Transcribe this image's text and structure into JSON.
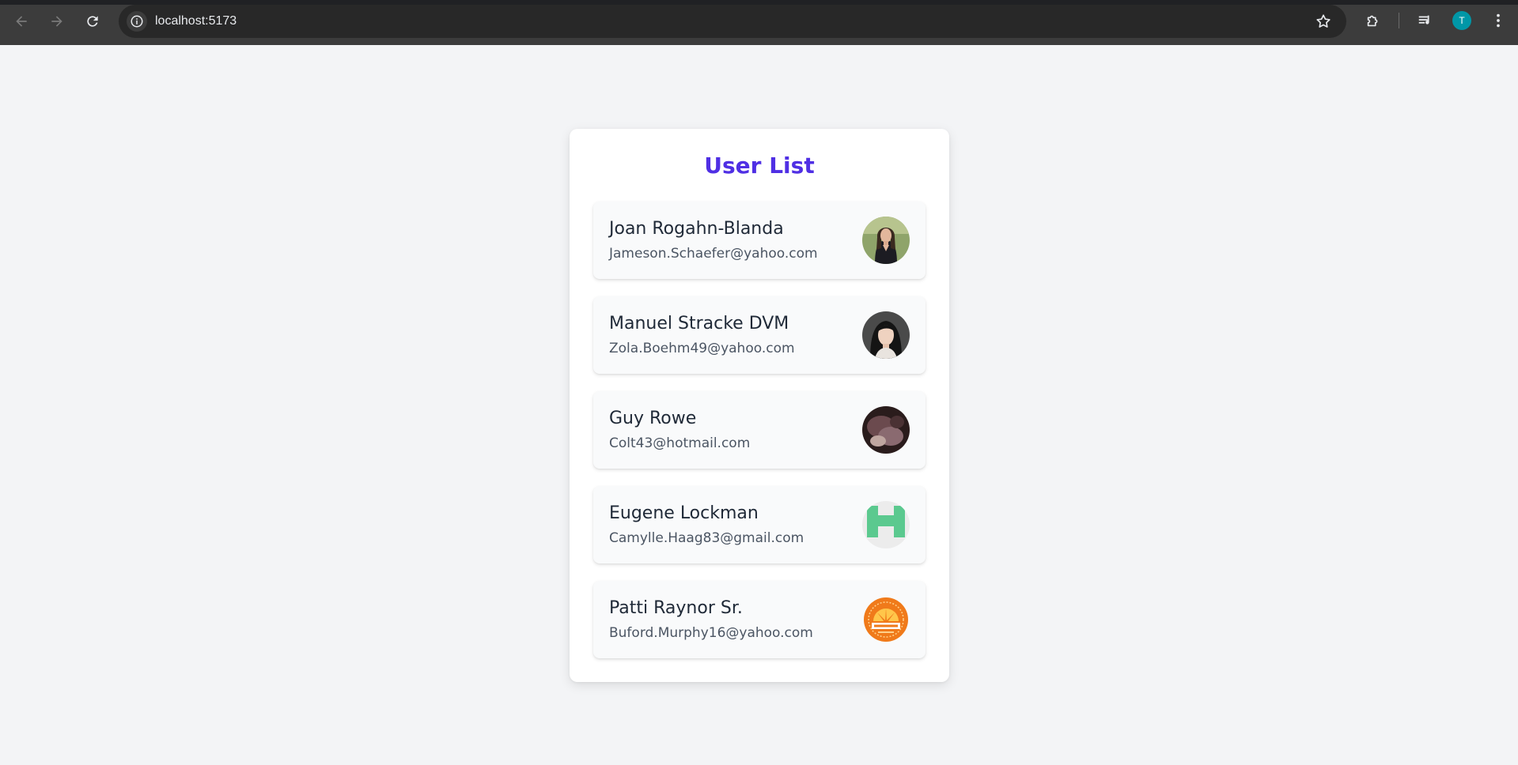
{
  "browser": {
    "url": "localhost:5173",
    "profile_initial": "T",
    "icons": [
      "back-arrow-icon",
      "forward-arrow-icon",
      "reload-icon",
      "site-info-icon",
      "bookmark-star-icon",
      "extensions-icon",
      "media-control-icon",
      "kebab-menu-icon"
    ]
  },
  "page": {
    "title": "User List"
  },
  "users": [
    {
      "name": "Joan Rogahn-Blanda",
      "email": "Jameson.Schaefer@yahoo.com",
      "avatar": "woman-portrait-photo"
    },
    {
      "name": "Manuel Stracke DVM",
      "email": "Zola.Boehm49@yahoo.com",
      "avatar": "woman-portrait-photo"
    },
    {
      "name": "Guy Rowe",
      "email": "Colt43@hotmail.com",
      "avatar": "dark-photo"
    },
    {
      "name": "Eugene Lockman",
      "email": "Camylle.Haag83@gmail.com",
      "avatar": "identicon"
    },
    {
      "name": "Patti Raynor Sr.",
      "email": "Buford.Murphy16@yahoo.com",
      "avatar": "community-badge-logo"
    }
  ],
  "colors": {
    "accent": "#4f2fe4",
    "page_bg": "#f3f4f6",
    "card_bg": "#ffffff",
    "item_bg": "#f9fafb",
    "name_text": "#1f2937",
    "email_text": "#4b5563"
  }
}
